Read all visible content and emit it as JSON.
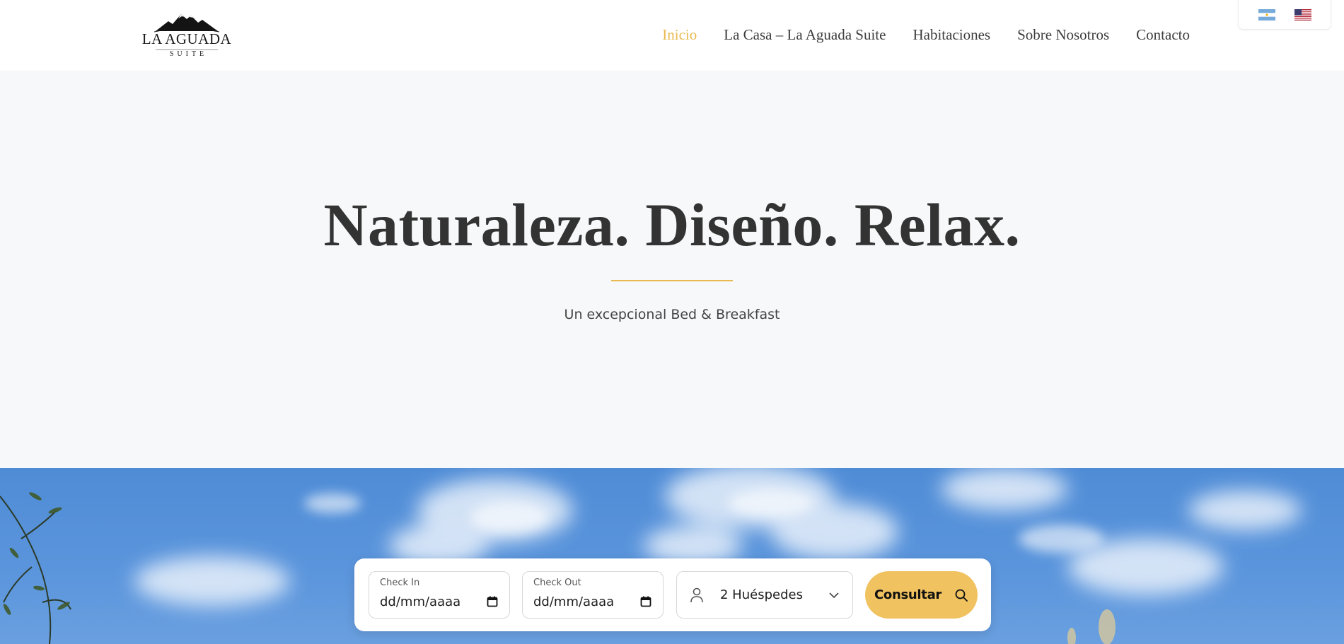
{
  "logo": {
    "name": "LA AGUADA",
    "sub": "SUITE"
  },
  "nav": {
    "items": [
      {
        "label": "Inicio",
        "active": true
      },
      {
        "label": "La Casa – La Aguada Suite",
        "active": false
      },
      {
        "label": "Habitaciones",
        "active": false
      },
      {
        "label": "Sobre Nosotros",
        "active": false
      },
      {
        "label": "Contacto",
        "active": false
      }
    ]
  },
  "languages": [
    {
      "icon": "argentina-flag-icon"
    },
    {
      "icon": "usa-flag-icon"
    }
  ],
  "hero": {
    "title": "Naturaleza. Diseño. Relax.",
    "subtitle": "Un excepcional Bed & Breakfast"
  },
  "booking": {
    "checkin_label": "Check In",
    "checkin_value": "dd/mm/aaaa",
    "checkout_label": "Check Out",
    "checkout_value": "dd/mm/aaaa",
    "guests_value": "2 Huéspedes",
    "submit_label": "Consultar"
  },
  "colors": {
    "accent": "#e8b94f",
    "button": "#f0c260",
    "hero_bg": "#f7f8f9",
    "sky": "#5b95dc"
  }
}
